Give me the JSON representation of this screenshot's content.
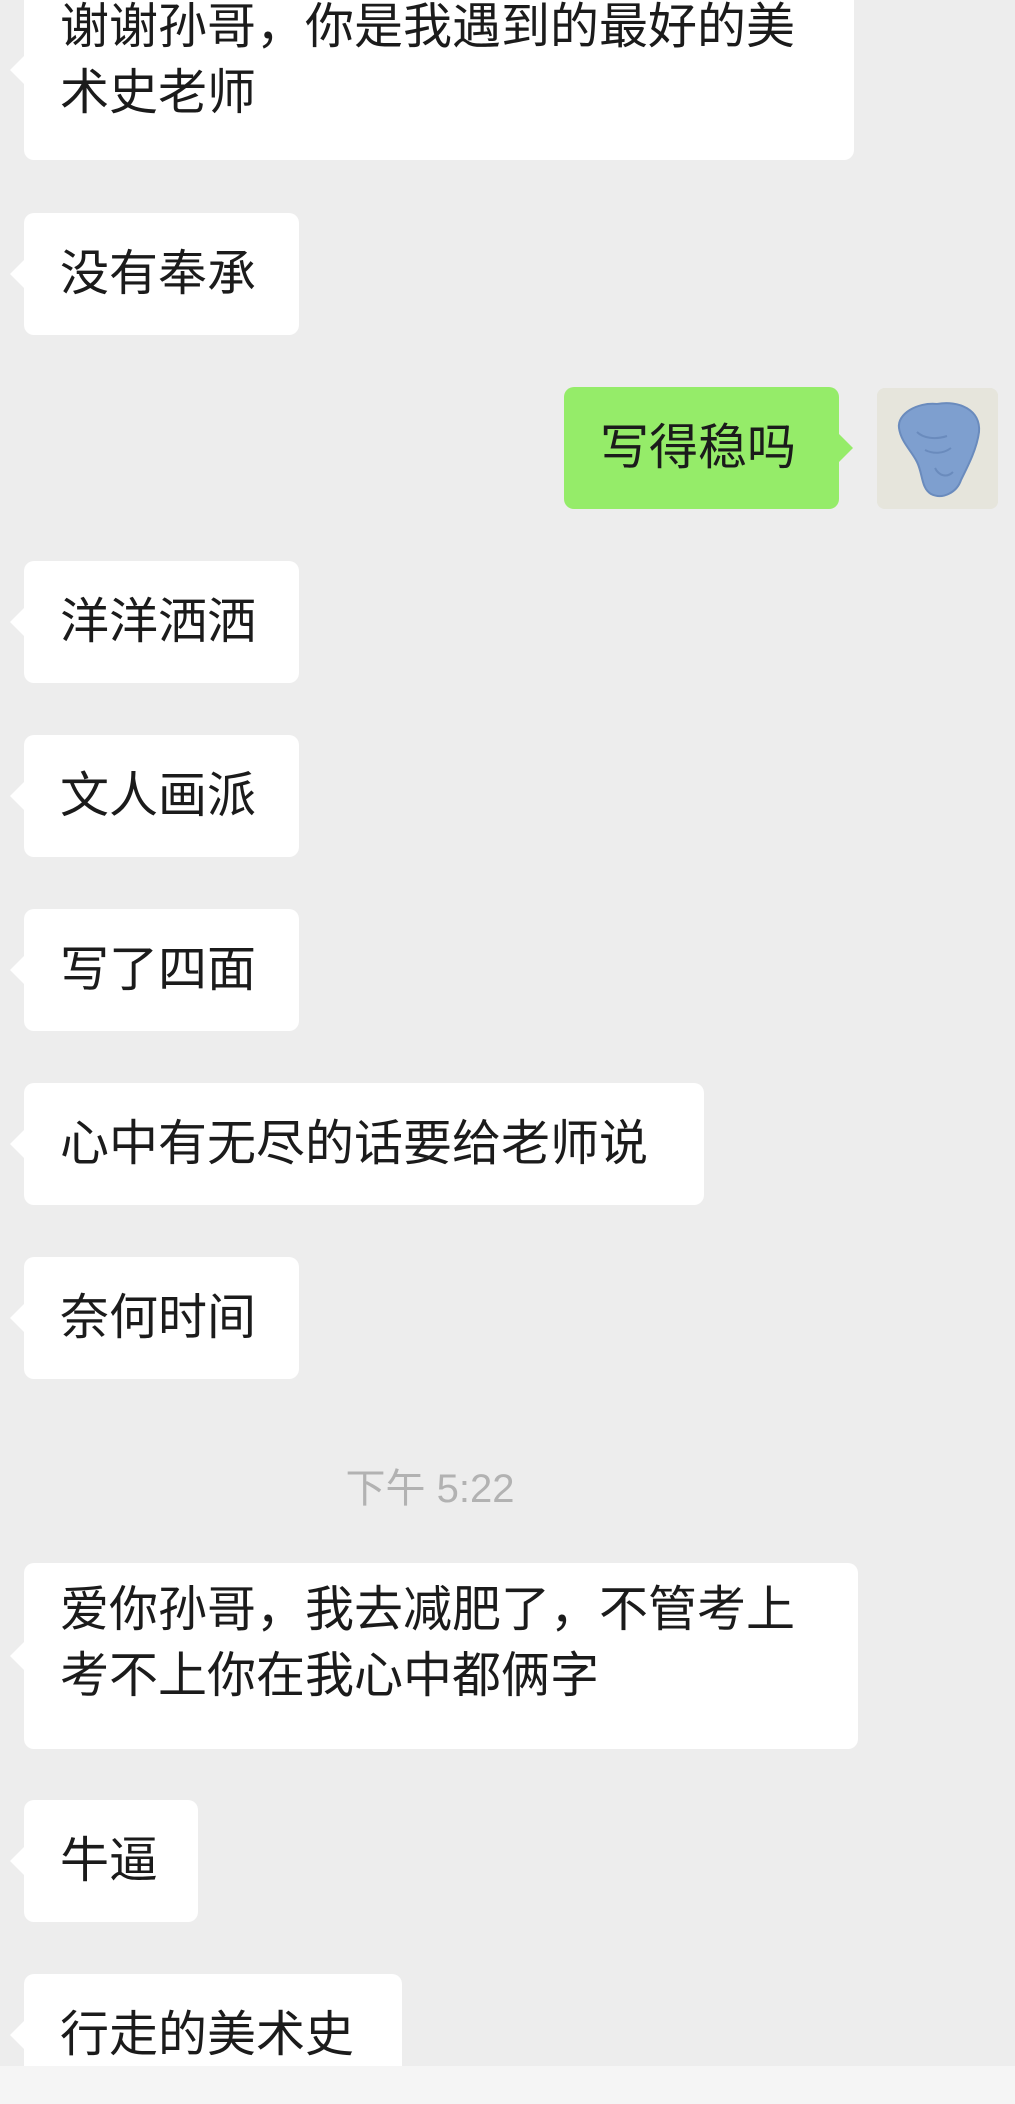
{
  "messages": [
    {
      "id": "m1",
      "direction": "in",
      "text": "谢谢孙哥，你是我遇到的最好的美\n术史老师"
    },
    {
      "id": "m2",
      "direction": "in",
      "text": "没有奉承"
    },
    {
      "id": "m3",
      "direction": "out",
      "text": "写得稳吗"
    },
    {
      "id": "m4",
      "direction": "in",
      "text": "洋洋洒洒"
    },
    {
      "id": "m5",
      "direction": "in",
      "text": "文人画派"
    },
    {
      "id": "m6",
      "direction": "in",
      "text": "写了四面"
    },
    {
      "id": "m7",
      "direction": "in",
      "text": "心中有无尽的话要给老师说"
    },
    {
      "id": "m8",
      "direction": "in",
      "text": "奈何时间"
    },
    {
      "id": "m9",
      "direction": "in",
      "text": "爱你孙哥，我去减肥了，不管考上\n考不上你在我心中都俩字"
    },
    {
      "id": "m10",
      "direction": "in",
      "text": "牛逼"
    },
    {
      "id": "m11",
      "direction": "in",
      "text": "行走的美术史"
    }
  ],
  "timestamp": "下午 5:22",
  "colors": {
    "background": "#ededed",
    "incoming_bubble": "#ffffff",
    "outgoing_bubble": "#95ec69",
    "timestamp_text": "#b2b2b2"
  },
  "icons": {
    "self_avatar": "blue-hand-avatar"
  }
}
